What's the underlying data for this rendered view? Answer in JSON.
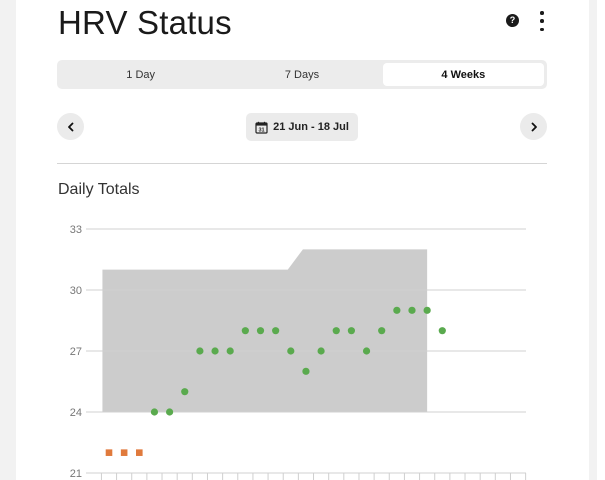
{
  "header": {
    "title": "HRV Status"
  },
  "icons": {
    "help": "help-circle-icon",
    "more": "more-vertical-icon"
  },
  "tabs": [
    {
      "label": "1 Day",
      "active": false
    },
    {
      "label": "7 Days",
      "active": false
    },
    {
      "label": "4 Weeks",
      "active": true
    }
  ],
  "date_nav": {
    "range": "21 Jun - 18 Jul",
    "calendar_day": "31"
  },
  "section": {
    "title": "Daily Totals"
  },
  "colors": {
    "baseline_band": "#cccccc",
    "in_range_point": "#5aaa4e",
    "low_point": "#e07a3c"
  },
  "chart_data": {
    "type": "scatter",
    "title": "Daily Totals",
    "ylim": [
      21,
      33
    ],
    "yticks": [
      33,
      30,
      27,
      24,
      21
    ],
    "grid": true,
    "days": 28,
    "baseline_band": [
      {
        "start_day": 1,
        "end_day": 13,
        "low": 24,
        "high": 31
      },
      {
        "start_day": 14,
        "end_day": 22,
        "low": 24,
        "high": 32
      }
    ],
    "series": [
      {
        "status": "below_baseline",
        "points": [
          {
            "day": 1,
            "value": 22
          },
          {
            "day": 2,
            "value": 22
          },
          {
            "day": 3,
            "value": 22
          }
        ]
      },
      {
        "status": "in_baseline",
        "points": [
          {
            "day": 4,
            "value": 24
          },
          {
            "day": 5,
            "value": 24
          },
          {
            "day": 6,
            "value": 25
          },
          {
            "day": 7,
            "value": 27
          },
          {
            "day": 8,
            "value": 27
          },
          {
            "day": 9,
            "value": 27
          },
          {
            "day": 10,
            "value": 28
          },
          {
            "day": 11,
            "value": 28
          },
          {
            "day": 12,
            "value": 28
          },
          {
            "day": 13,
            "value": 27
          },
          {
            "day": 14,
            "value": 26
          },
          {
            "day": 15,
            "value": 27
          },
          {
            "day": 16,
            "value": 28
          },
          {
            "day": 17,
            "value": 28
          },
          {
            "day": 18,
            "value": 27
          },
          {
            "day": 19,
            "value": 28
          },
          {
            "day": 20,
            "value": 29
          },
          {
            "day": 21,
            "value": 29
          },
          {
            "day": 22,
            "value": 29
          },
          {
            "day": 23,
            "value": 28
          }
        ]
      }
    ]
  }
}
